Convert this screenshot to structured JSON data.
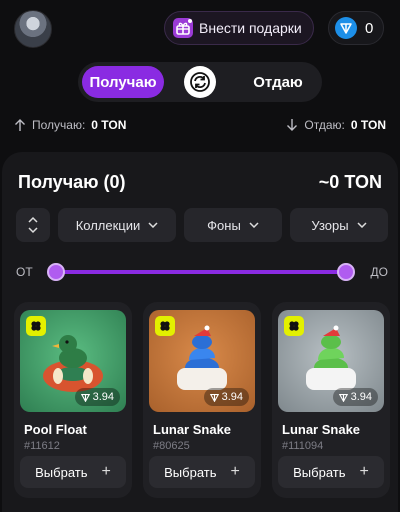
{
  "header": {
    "gift_button_label": "Внести подарки",
    "balance": "0",
    "icons": {
      "avatar": "avatar",
      "gift": "gift-icon",
      "ton": "ton-icon"
    }
  },
  "mode_toggle": {
    "receive_label": "Получаю",
    "give_label": "Отдаю",
    "swap_icon": "swap-icon",
    "active": "receive"
  },
  "summary": {
    "receive_label": "Получаю:",
    "receive_value": "0 TON",
    "give_label": "Отдаю:",
    "give_value": "0 TON"
  },
  "panel": {
    "title": "Получаю (0)",
    "total": "~0 TON",
    "filters": [
      "Коллекции",
      "Фоны",
      "Узоры"
    ],
    "range_from": "ОТ",
    "range_to": "ДО"
  },
  "cards": [
    {
      "name": "Pool Float",
      "number": "#11612",
      "price": "3.94",
      "button": "Выбрать",
      "bg": "#3f9e66"
    },
    {
      "name": "Lunar Snake",
      "number": "#80625",
      "price": "3.94",
      "button": "Выбрать",
      "bg": "#c47a3f"
    },
    {
      "name": "Lunar Snake",
      "number": "#111094",
      "price": "3.94",
      "button": "Выбрать",
      "bg": "#9aa3a8"
    }
  ],
  "colors": {
    "accent": "#8a2be2",
    "background": "#0e0e10",
    "panel": "#18181b",
    "ton": "#1d8fe8",
    "clover": "#e3f000"
  }
}
